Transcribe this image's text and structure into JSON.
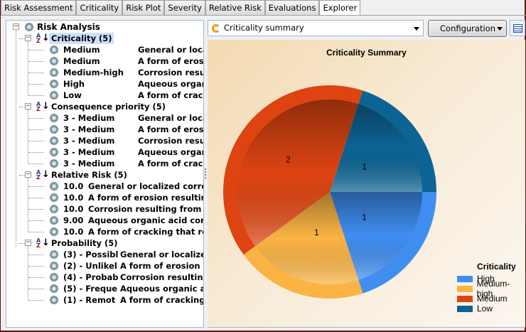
{
  "tabs": [
    "Risk Assessment",
    "Criticality",
    "Risk Plot",
    "Severity",
    "Relative Risk",
    "Evaluations",
    "Explorer"
  ],
  "active_tab": "Explorer",
  "tree": {
    "root": "Risk Analysis",
    "groups": [
      {
        "label": "Criticality (5)",
        "selected": true,
        "items": [
          [
            "Medium",
            "General or locali"
          ],
          [
            "Medium",
            "A form of erosion"
          ],
          [
            "Medium-high",
            "Corrosion resulti"
          ],
          [
            "High",
            "Aqueous organic"
          ],
          [
            "Low",
            "A form of crackin"
          ]
        ]
      },
      {
        "label": "Consequence priority (5)",
        "items": [
          [
            "3 - Medium",
            "General or locali"
          ],
          [
            "3 - Medium",
            "A form of erosion"
          ],
          [
            "3 - Medium",
            "Corrosion resulti"
          ],
          [
            "3 - Medium",
            "Aqueous organic"
          ],
          [
            "3 - Medium",
            "A form of crackin"
          ]
        ]
      },
      {
        "label": "Relative Risk (5)",
        "items": [
          [
            "10.0",
            "General or localized corrosion"
          ],
          [
            "10.0",
            "A form of erosion resulting in"
          ],
          [
            "10.0",
            "Corrosion resulting from wat"
          ],
          [
            "9.00",
            "Aqueous organic acid corrosi"
          ],
          [
            "10.0",
            "A form of cracking that resul"
          ]
        ]
      },
      {
        "label": "Probability (5)",
        "items": [
          [
            "(3) - Possibl",
            "General or localized c"
          ],
          [
            "(2) - Unlikel",
            "A form of erosion res"
          ],
          [
            "(4) - Probab",
            "Corrosion resulting fr"
          ],
          [
            "(5) - Freque",
            "Aqueous organic acid"
          ],
          [
            "(1) - Remot",
            "A form of cracking th"
          ]
        ]
      }
    ]
  },
  "combo_value": "Criticality summary",
  "config_label": "Configuration",
  "chart_data": {
    "type": "pie",
    "title": "Criticality Summary",
    "legend_title": "Criticality",
    "legend_position": "bottom-right",
    "categories": [
      "High",
      "Medium-high",
      "Medium",
      "Low"
    ],
    "values": [
      1,
      1,
      2,
      1
    ],
    "colors": [
      "#3f8ef0",
      "#fbb443",
      "#dd4412",
      "#0c6494"
    ]
  }
}
